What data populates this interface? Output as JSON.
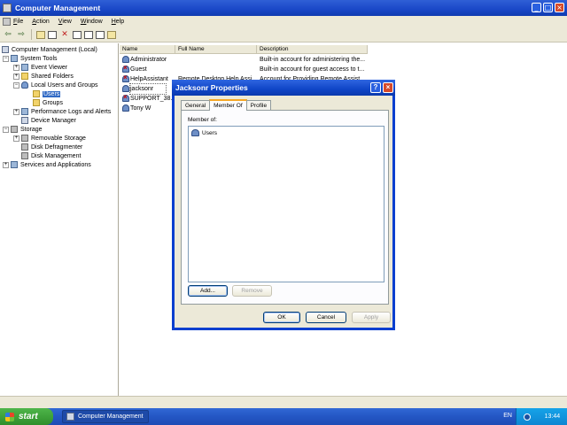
{
  "window": {
    "title": "Computer Management"
  },
  "menu": [
    "File",
    "Action",
    "View",
    "Window",
    "Help"
  ],
  "tree": [
    {
      "label": "Computer Management (Local)",
      "depth": 0,
      "expander": ""
    },
    {
      "label": "System Tools",
      "depth": 1,
      "expander": "−"
    },
    {
      "label": "Event Viewer",
      "depth": 2,
      "expander": "+"
    },
    {
      "label": "Shared Folders",
      "depth": 2,
      "expander": "+"
    },
    {
      "label": "Local Users and Groups",
      "depth": 2,
      "expander": "−"
    },
    {
      "label": "Users",
      "depth": 3,
      "expander": ""
    },
    {
      "label": "Groups",
      "depth": 3,
      "expander": ""
    },
    {
      "label": "Performance Logs and Alerts",
      "depth": 2,
      "expander": "+"
    },
    {
      "label": "Device Manager",
      "depth": 2,
      "expander": ""
    },
    {
      "label": "Storage",
      "depth": 1,
      "expander": "−"
    },
    {
      "label": "Removable Storage",
      "depth": 2,
      "expander": "+"
    },
    {
      "label": "Disk Defragmenter",
      "depth": 2,
      "expander": ""
    },
    {
      "label": "Disk Management",
      "depth": 2,
      "expander": ""
    },
    {
      "label": "Services and Applications",
      "depth": 1,
      "expander": "+"
    }
  ],
  "list": {
    "columns": [
      "Name",
      "Full Name",
      "Description"
    ],
    "rows": [
      {
        "name": "Administrator",
        "fullname": "",
        "description": "Built-in account for administering the..."
      },
      {
        "name": "Guest",
        "fullname": "",
        "description": "Built-in account for guest access to t..."
      },
      {
        "name": "HelpAssistant",
        "fullname": "Remote Desktop Help Assi...",
        "description": "Account for Providing Remote Assist..."
      },
      {
        "name": "jacksonr",
        "fullname": "",
        "description": ""
      },
      {
        "name": "SUPPORT_38...",
        "fullname": "",
        "description": ""
      },
      {
        "name": "Tony W",
        "fullname": "",
        "description": ""
      }
    ]
  },
  "dialog": {
    "title": "Jacksonr Properties",
    "tabs": [
      "General",
      "Member Of",
      "Profile"
    ],
    "member_label": "Member of:",
    "members": [
      "Users"
    ],
    "add_label": "Add...",
    "remove_label": "Remove",
    "ok_label": "OK",
    "cancel_label": "Cancel",
    "apply_label": "Apply"
  },
  "taskbar": {
    "start_label": "start",
    "task_label": "Computer Management",
    "language": "EN",
    "clock": "13:44"
  }
}
